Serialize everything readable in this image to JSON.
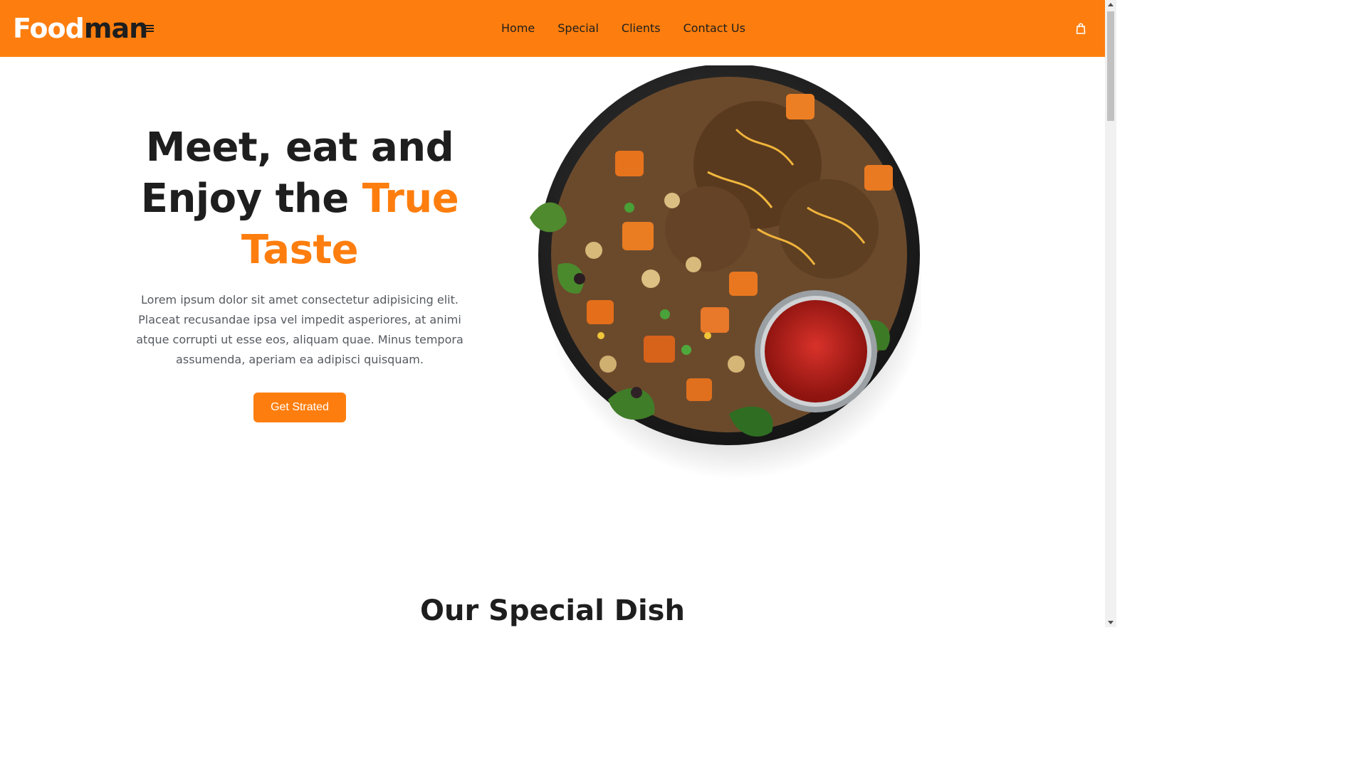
{
  "brand": {
    "logo_part1": "Food",
    "logo_part2": "man"
  },
  "nav": {
    "items": [
      {
        "label": "Home"
      },
      {
        "label": "Special"
      },
      {
        "label": "Clients"
      },
      {
        "label": "Contact Us"
      }
    ]
  },
  "hero": {
    "title_line1": "Meet, eat and",
    "title_line2_a": "Enjoy the ",
    "title_line2_b": "True",
    "title_line3": "Taste",
    "description": "Lorem ipsum dolor sit amet consectetur adipisicing elit. Placeat recusandae ipsa vel impedit asperiores, at animi atque corrupti ut esse eos, aliquam quae. Minus tempora assumenda, aperiam ea adipisci quisquam.",
    "cta_label": "Get Strated"
  },
  "sections": {
    "special_title": "Our Special Dish"
  },
  "colors": {
    "accent": "#fd7e0e",
    "dark": "#1e1e1e",
    "text_muted": "#555a60"
  },
  "icons": {
    "menu": "hamburger-icon",
    "cart": "shopping-bag-icon"
  }
}
